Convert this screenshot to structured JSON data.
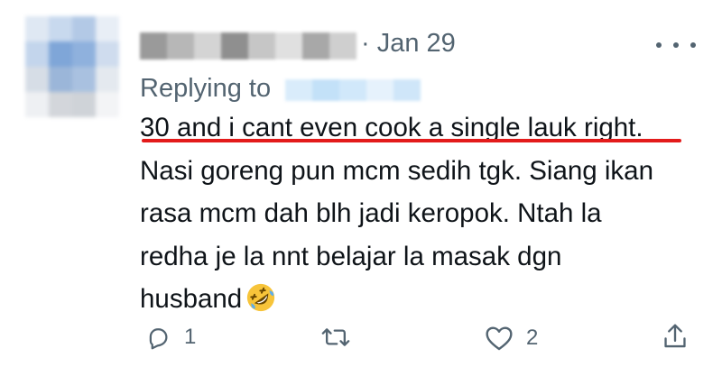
{
  "header": {
    "date": "· Jan 29"
  },
  "reply": {
    "prefix": "Replying to"
  },
  "tweet": {
    "lines": [
      "30 and i cant even cook a single lauk right.",
      "Nasi goreng pun mcm sedih tgk. Siang ikan",
      "rasa mcm dah blh jadi keropok. Ntah la",
      "redha je la nnt belajar la masak dgn",
      "husband"
    ],
    "emoji": "rolling-on-the-floor-laughing-emoji",
    "highlight_color": "#e31b1b"
  },
  "actions": {
    "reply_count": "1",
    "retweet_count": "",
    "like_count": "2"
  },
  "colors": {
    "text": "#0f1419",
    "secondary": "#536471"
  }
}
